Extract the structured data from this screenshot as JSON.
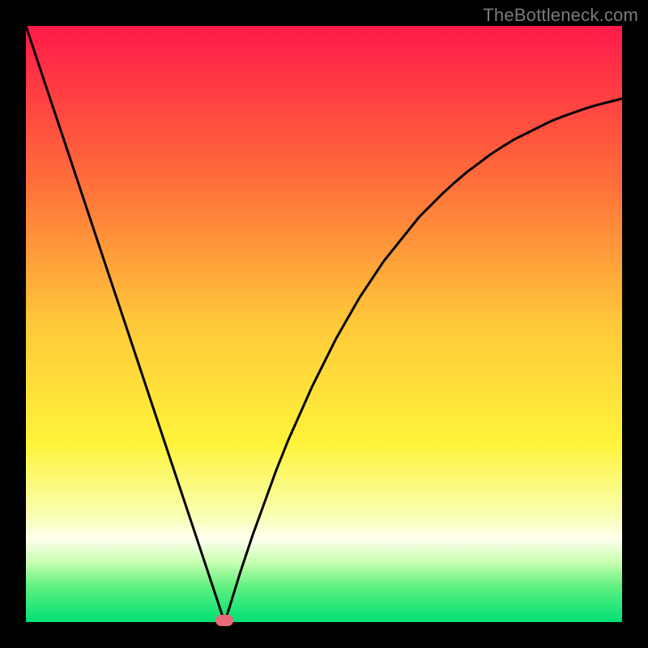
{
  "attribution": "TheBottleneck.com",
  "chart_data": {
    "type": "line",
    "title": "",
    "xlabel": "",
    "ylabel": "",
    "xlim": [
      0,
      100
    ],
    "ylim": [
      0,
      100
    ],
    "x": [
      0,
      2,
      4,
      6,
      8,
      10,
      12,
      14,
      16,
      18,
      20,
      22,
      24,
      26,
      28,
      30,
      32,
      33.3,
      34,
      36,
      38,
      40,
      42,
      44,
      46,
      48,
      50,
      52,
      54,
      56,
      58,
      60,
      62,
      64,
      66,
      68,
      70,
      72,
      74,
      76,
      78,
      80,
      82,
      84,
      86,
      88,
      90,
      92,
      94,
      96,
      98,
      100
    ],
    "values": [
      100,
      94,
      88,
      82,
      76,
      70,
      64,
      58,
      52,
      46,
      40,
      34,
      28,
      22,
      16,
      10,
      4,
      0,
      2,
      8.5,
      14.5,
      20,
      25.5,
      30.5,
      35,
      39.5,
      43.5,
      47.5,
      51,
      54.5,
      57.5,
      60.5,
      63,
      65.5,
      68,
      70,
      72,
      73.8,
      75.5,
      77,
      78.5,
      79.8,
      81,
      82,
      83,
      84,
      84.8,
      85.5,
      86.2,
      86.8,
      87.3,
      87.8
    ],
    "min_point": {
      "x": 33.3,
      "y": 0
    },
    "background": {
      "type": "vertical-gradient",
      "stops": [
        {
          "offset": 0.0,
          "color": "#ff1a4a"
        },
        {
          "offset": 0.25,
          "color": "#ff6a3a"
        },
        {
          "offset": 0.5,
          "color": "#ffc93a"
        },
        {
          "offset": 0.7,
          "color": "#fff33a"
        },
        {
          "offset": 0.82,
          "color": "#f8ffb0"
        },
        {
          "offset": 0.86,
          "color": "#ffffee"
        },
        {
          "offset": 0.9,
          "color": "#c8ffb0"
        },
        {
          "offset": 0.94,
          "color": "#60f080"
        },
        {
          "offset": 1.0,
          "color": "#00e074"
        }
      ]
    },
    "marker": {
      "shape": "rounded",
      "color": "#e86a7a",
      "size": 20
    }
  }
}
